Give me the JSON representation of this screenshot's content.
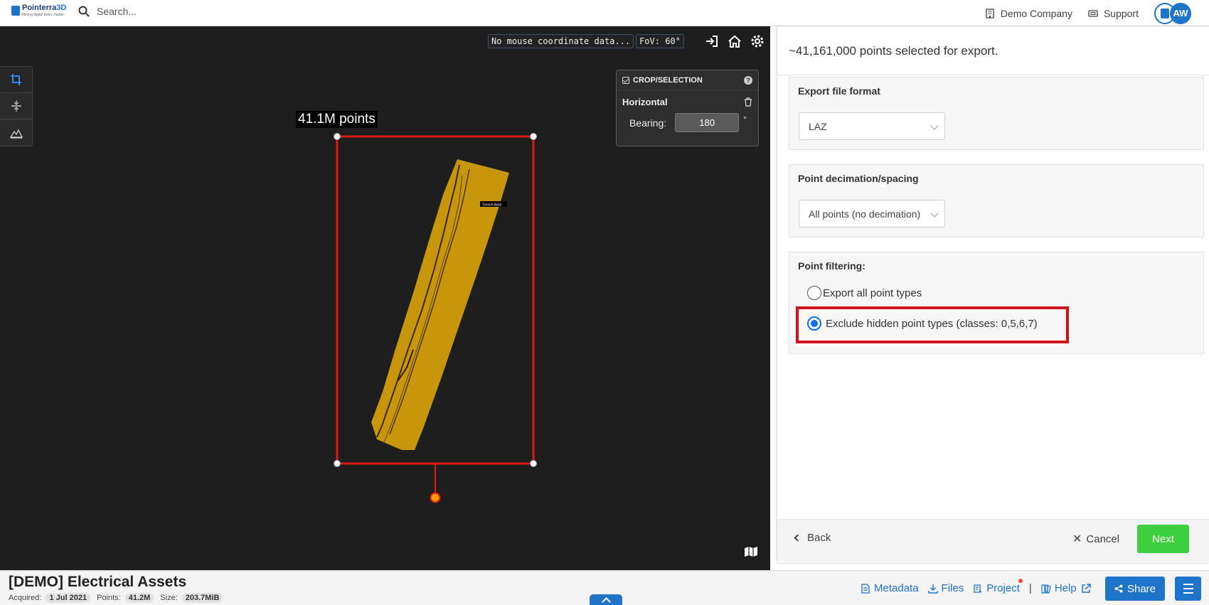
{
  "app": {
    "logo_name_a": "Pointerra",
    "logo_name_b": "3D",
    "logo_tagline": "Mining digital twins. Faster.",
    "search_placeholder": "Search...",
    "company": "Demo Company",
    "support": "Support",
    "user_initials": "AW"
  },
  "viewer": {
    "coord_readout": "No mouse coordinate data...",
    "fov": "FoV: 60°",
    "points_label": "41.1M points",
    "area_label": "Trench Area",
    "crop_panel": {
      "title": "CROP/SELECTION",
      "help": "?",
      "mode": "Horizontal",
      "bearing_label": "Bearing:",
      "bearing_value": "180",
      "bearing_unit": "°"
    },
    "tools": [
      "crop-icon",
      "section-icon",
      "terrain-icon"
    ]
  },
  "export": {
    "heading": "~41,161,000 points selected for export.",
    "format_label": "Export file format",
    "format_value": "LAZ",
    "decimation_label": "Point decimation/spacing",
    "decimation_value": "All points (no decimation)",
    "filtering_label": "Point filtering:",
    "options": [
      {
        "label": "Export all point types",
        "selected": false
      },
      {
        "label": "Exclude hidden point types (classes: 0,5,6,7)",
        "selected": true
      }
    ],
    "back": "Back",
    "cancel": "Cancel",
    "next": "Next"
  },
  "project": {
    "title": "[DEMO] Electrical Assets",
    "acquired_label": "Acquired:",
    "acquired_value": "1 Jul 2021",
    "points_label": "Points:",
    "points_value": "41.2M",
    "size_label": "Size:",
    "size_value": "203.7MiB"
  },
  "bottom_links": {
    "metadata": "Metadata",
    "files": "Files",
    "project": "Project",
    "separator": "|",
    "help": "Help",
    "share": "Share"
  },
  "colors": {
    "brand": "#1e74c8",
    "selection_box": "#e01818",
    "point_cloud": "#c8960a",
    "highlight": "#d0101a",
    "next_button": "#3ecf3e"
  }
}
